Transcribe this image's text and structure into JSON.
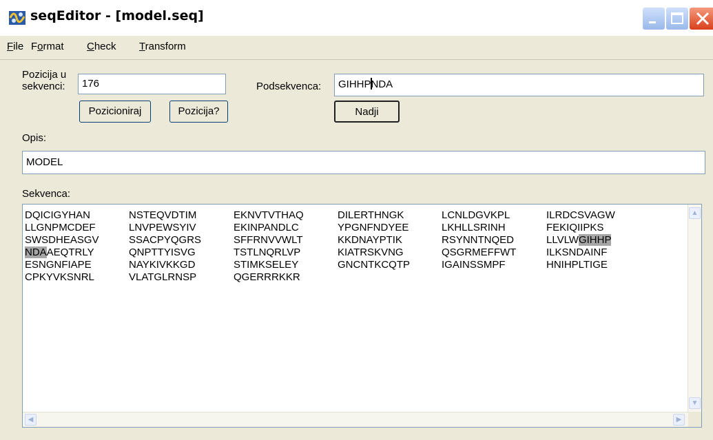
{
  "window": {
    "title": "seqEditor - [model.seq]"
  },
  "menu": [
    {
      "pre": "",
      "u": "F",
      "post": "ile"
    },
    {
      "pre": "F",
      "u": "o",
      "post": "rmat"
    },
    {
      "pre": "",
      "u": "C",
      "post": "heck"
    },
    {
      "pre": "",
      "u": "T",
      "post": "ransform"
    }
  ],
  "position": {
    "label_line1": "Pozicija u",
    "label_line2": "sekvenci:",
    "value": "176",
    "position_button": "Pozicioniraj",
    "query_button": "Pozicija?"
  },
  "search": {
    "label": "Podsekvenca:",
    "value_before_caret": "GIHHP",
    "value_after_caret": "NDA",
    "find_button": "Nadji"
  },
  "description": {
    "label": "Opis:",
    "value": "MODEL"
  },
  "sequence": {
    "label": "Sekvenca:",
    "rows": [
      [
        "DQICIGYHAN",
        "NSTEQVDTIM",
        "EKNVTVTHAQ",
        "DILERTHNGK",
        "LCNLDGVKPL",
        "ILRDCSVAGW"
      ],
      [
        "LLGNPMCDEF",
        "LNVPEWSYIV",
        "EKINPANDLC",
        "YPGNFNDYEE",
        "LKHLLSRINH",
        "FEKIQIIPKS"
      ],
      [
        "SWSDHEASGV",
        "SSACPYQGRS",
        "SFFRNVVWLT",
        "KKDNAYPTIK",
        "RSYNNTNQED",
        "LLVLWGIHHP"
      ],
      [
        "NDAAEQTRLY",
        "QNPTTYISVG",
        "TSTLNQRLVP",
        "KIATRSKVNG",
        "QSGRMEFFWT",
        "ILKSNDAINF"
      ],
      [
        "ESNGNFIAPE",
        "NAYKIVKKGD",
        "STIMKSELEY",
        "GNCNTKCQTP",
        "IGAINSSMPF",
        "HNIHPLTIGE"
      ],
      [
        "CPKYVKSNRL",
        "VLATGLRNSP",
        "QGERRRKKR",
        "",
        "",
        ""
      ]
    ],
    "highlight": {
      "row3_plain": "LLVLW",
      "row3_match": "GIHHP",
      "row4_match": "NDA",
      "row4_plain": "AEQTRLY"
    }
  },
  "scrollbars": {
    "up_icon": "▲",
    "down_icon": "▼",
    "left_icon": "◀",
    "right_icon": "▶"
  }
}
